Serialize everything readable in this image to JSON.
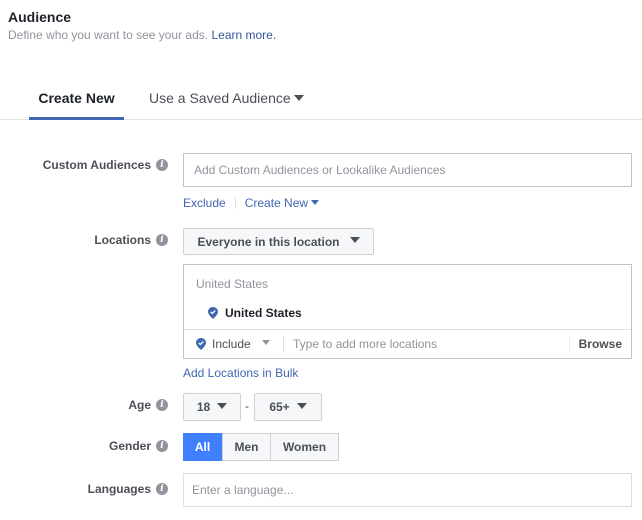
{
  "header": {
    "title": "Audience",
    "subtitle": "Define who you want to see your ads.",
    "learn_more": "Learn more."
  },
  "tabs": [
    {
      "label": "Create New",
      "active": true
    },
    {
      "label": "Use a Saved Audience",
      "active": false
    }
  ],
  "custom_audiences": {
    "label": "Custom Audiences",
    "placeholder": "Add Custom Audiences or Lookalike Audiences",
    "exclude": "Exclude",
    "create_new": "Create New"
  },
  "locations": {
    "label": "Locations",
    "dropdown_value": "Everyone in this location",
    "country_header": "United States",
    "selected": "United States",
    "include_label": "Include",
    "search_placeholder": "Type to add more locations",
    "browse": "Browse",
    "bulk_link": "Add Locations in Bulk"
  },
  "age": {
    "label": "Age",
    "min": "18",
    "separator": "-",
    "max": "65+"
  },
  "gender": {
    "label": "Gender",
    "options": [
      "All",
      "Men",
      "Women"
    ],
    "selected": "All"
  },
  "languages": {
    "label": "Languages",
    "placeholder": "Enter a language..."
  },
  "colors": {
    "accent": "#4267b2",
    "active_button": "#4080ff",
    "link": "#4267b2"
  }
}
